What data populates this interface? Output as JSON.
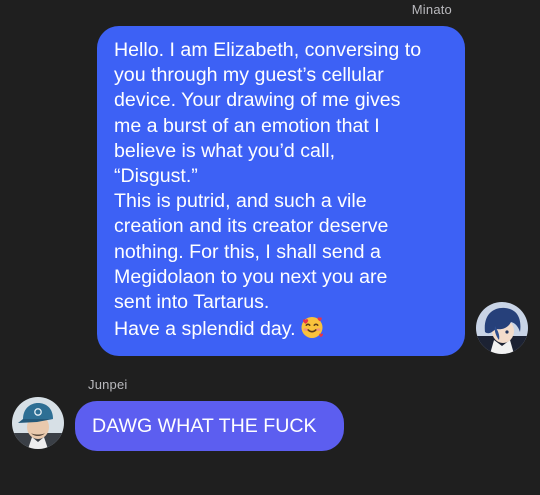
{
  "outgoing": {
    "sender": "Minato",
    "lines": [
      "Hello. I am Elizabeth, conversing to",
      "you through my guest’s cellular",
      "device. Your drawing of me gives",
      "me a burst of an emotion that I",
      "believe is what you’d call,",
      "“Disgust.”",
      "This is putrid, and such a vile",
      "creation and its creator deserve",
      "nothing. For this, I shall send a",
      "Megidolaon to you next you are",
      "sent into Tartarus.",
      "Have a splendid day."
    ],
    "emoji": "smiling-face-with-hearts-icon",
    "avatar": "minato-avatar"
  },
  "incoming": {
    "sender": "Junpei",
    "text": "DAWG WHAT THE FUCK",
    "avatar": "junpei-avatar"
  },
  "colors": {
    "background": "#1f1f1f",
    "outgoing_bubble": "#3d61f5",
    "incoming_bubble": "#5c5ef0",
    "sender_name": "#b9b9bd"
  }
}
